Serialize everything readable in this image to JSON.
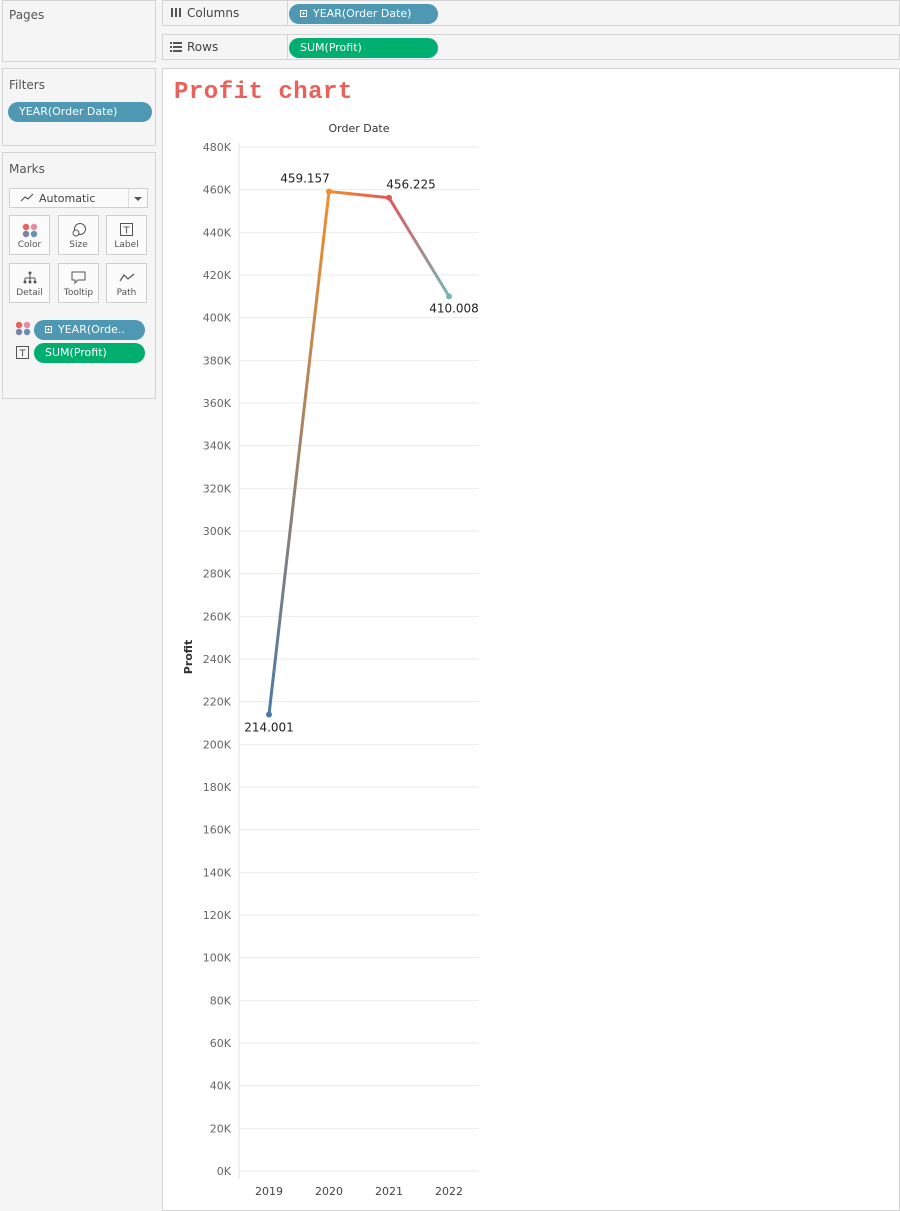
{
  "pages": {
    "title": "Pages"
  },
  "filters": {
    "title": "Filters",
    "pill": "YEAR(Order Date)"
  },
  "marks": {
    "title": "Marks",
    "type_label": "Automatic",
    "buttons": [
      "Color",
      "Size",
      "Label",
      "Detail",
      "Tooltip",
      "Path"
    ],
    "fields": [
      {
        "label": "YEAR(Orde..",
        "kind": "dimension",
        "icon": "color-icon"
      },
      {
        "label": "SUM(Profit)",
        "kind": "measure",
        "icon": "label-icon"
      }
    ]
  },
  "shelves": {
    "columns_label": "Columns",
    "columns_pill": "YEAR(Order Date)",
    "rows_label": "Rows",
    "rows_pill": "SUM(Profit)"
  },
  "colors": {
    "dimension_pill": "#4e98b3",
    "measure_pill": "#00af70",
    "title": "#e8615a"
  },
  "chart_data": {
    "type": "line",
    "title": "Profit chart",
    "header": "Order Date",
    "ylabel": "Profit",
    "ylim": [
      0,
      480000
    ],
    "yticks": [
      "0K",
      "20K",
      "40K",
      "60K",
      "80K",
      "100K",
      "120K",
      "140K",
      "160K",
      "180K",
      "200K",
      "220K",
      "240K",
      "260K",
      "280K",
      "300K",
      "320K",
      "340K",
      "360K",
      "380K",
      "400K",
      "420K",
      "440K",
      "460K",
      "480K"
    ],
    "grid": true,
    "categories": [
      "2019",
      "2020",
      "2021",
      "2022"
    ],
    "values": [
      214001,
      459157,
      456225,
      410008
    ],
    "value_labels": [
      "214.001",
      "459.157",
      "456.225",
      "410.008"
    ],
    "point_colors": [
      "#4e79a7",
      "#f28e2b",
      "#e15759",
      "#76b7b2"
    ]
  }
}
